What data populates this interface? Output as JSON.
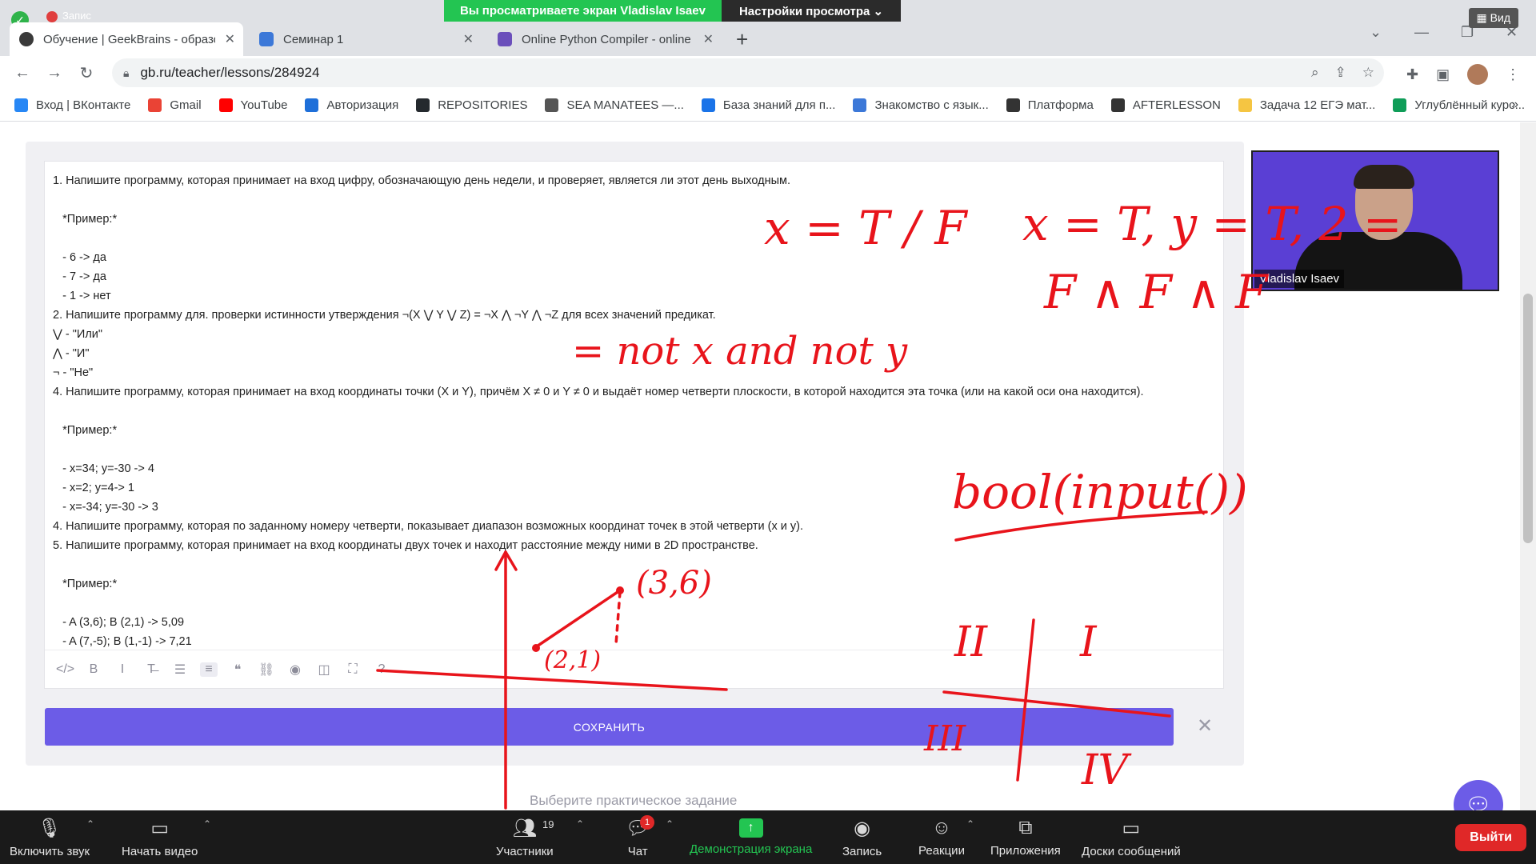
{
  "zoom_banner": {
    "viewing": "Вы просматриваете экран Vladislav Isaev",
    "view_settings": "Настройки просмотра ⌄",
    "view_btn": "Вид",
    "recording": "Запис"
  },
  "browser": {
    "tabs": [
      {
        "title": "Обучение | GeekBrains - образо",
        "active": true,
        "color": "#3a3a3a"
      },
      {
        "title": "Семинар 1",
        "active": false,
        "color": "#3c78d8"
      },
      {
        "title": "Online Python Compiler - online",
        "active": false,
        "color": "#6b4fbb"
      }
    ],
    "url": "gb.ru/teacher/lessons/284924",
    "bookmarks": [
      {
        "label": "Вход | ВКонтакте",
        "color": "#2787f5"
      },
      {
        "label": "Gmail",
        "color": "#ea4335"
      },
      {
        "label": "YouTube",
        "color": "#ff0000"
      },
      {
        "label": "Авторизация",
        "color": "#1e6fd9"
      },
      {
        "label": "REPOSITORIES",
        "color": "#24292e"
      },
      {
        "label": "SEA MANATEES —...",
        "color": "#555555"
      },
      {
        "label": "База знаний для п...",
        "color": "#1a73e8"
      },
      {
        "label": "Знакомство с язык...",
        "color": "#3c78d8"
      },
      {
        "label": "Платформа",
        "color": "#333333"
      },
      {
        "label": "AFTERLESSON",
        "color": "#333333"
      },
      {
        "label": "Задача 12 ЕГЭ мат...",
        "color": "#f5c542"
      },
      {
        "label": "Углублённый курс...",
        "color": "#0f9d58"
      }
    ]
  },
  "editor": {
    "lines": [
      "1. Напишите программу, которая принимает на вход цифру, обозначающую день недели, и проверяет, является ли этот день выходным.",
      "",
      "   *Пример:*",
      "",
      "   - 6 -> да",
      "   - 7 -> да",
      "   - 1 -> нет",
      "2. Напишите программу для. проверки истинности утверждения ¬(X ⋁ Y ⋁ Z) = ¬X ⋀ ¬Y ⋀ ¬Z для всех значений предикат.",
      "⋁ - \"Или\"",
      "⋀ - \"И\"",
      "¬ - \"Не\"",
      "4. Напишите программу, которая принимает на вход координаты точки (X и Y), причём X ≠ 0 и Y ≠ 0 и выдаёт номер четверти плоскости, в которой находится эта точка (или на какой оси она находится).",
      "",
      "   *Пример:*",
      "",
      "   - x=34; y=-30 -> 4",
      "   - x=2; y=4-> 1",
      "   - x=-34; y=-30 -> 3",
      "4. Напишите программу, которая по заданному номеру четверти, показывает диапазон возможных координат точек в этой четверти (x и y).",
      "5. Напишите программу, которая принимает на вход координаты двух точек и находит расстояние между ними в 2D пространстве.",
      "",
      "   *Пример:*",
      "",
      "   - A (3,6); B (2,1) -> 5,09",
      "   - A (7,-5); B (1,-1) -> 7,21"
    ],
    "toolbar_icons": [
      "code-icon",
      "bold-icon",
      "italic-icon",
      "strikethrough-icon",
      "bullet-list-icon",
      "numbered-list-icon",
      "quote-icon",
      "link-icon",
      "preview-icon",
      "side-by-side-icon",
      "fullscreen-icon",
      "help-icon"
    ],
    "save_label": "СОХРАНИТЬ",
    "practice_placeholder": "Выберите практическое задание"
  },
  "video": {
    "name": "Vladislav Isaev"
  },
  "annotations": {
    "t1": "x = T / F",
    "t2": "x = T, y = T, 2 =",
    "t3": "F ∧ F ∧ F",
    "t4": "= not x and not y",
    "t5": "bool(input())",
    "t6": "(3,6)",
    "t7": "(2,1)",
    "t8": "II",
    "t9": "I",
    "t10": "III",
    "t11": "IV"
  },
  "zoom_bar": {
    "mute": "Включить звук",
    "video": "Начать видео",
    "participants": "Участники",
    "participants_count": "19",
    "chat": "Чат",
    "chat_badge": "1",
    "share": "Демонстрация экрана",
    "record": "Запись",
    "reactions": "Реакции",
    "apps": "Приложения",
    "whiteboards": "Доски сообщений",
    "leave": "Выйти"
  }
}
